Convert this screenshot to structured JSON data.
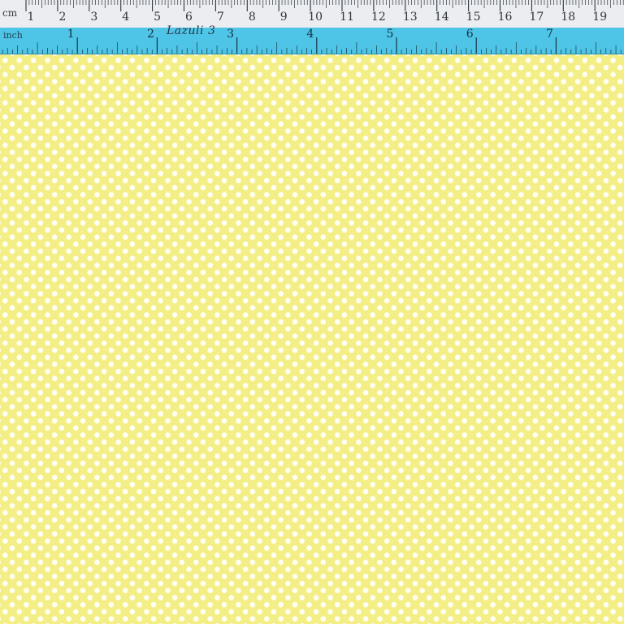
{
  "ruler": {
    "cm_unit": "cm",
    "inch_unit": "inch",
    "cm_labels": [
      "1",
      "2",
      "3",
      "4",
      "5",
      "6",
      "7",
      "8",
      "9",
      "10",
      "11",
      "12",
      "13",
      "14",
      "15",
      "16",
      "17",
      "18",
      "19",
      "2"
    ],
    "inch_labels": [
      "1",
      "2",
      "3",
      "4",
      "5",
      "6",
      "7"
    ],
    "handwritten": "Lazuli 3"
  },
  "colors": {
    "fabric": "#f3ee86",
    "dot": "#fffef2",
    "cm_ruler": "#ecedf0",
    "inch_ruler": "#4ec5e6",
    "tick": "#2b3540"
  },
  "pattern": "polka-dot"
}
